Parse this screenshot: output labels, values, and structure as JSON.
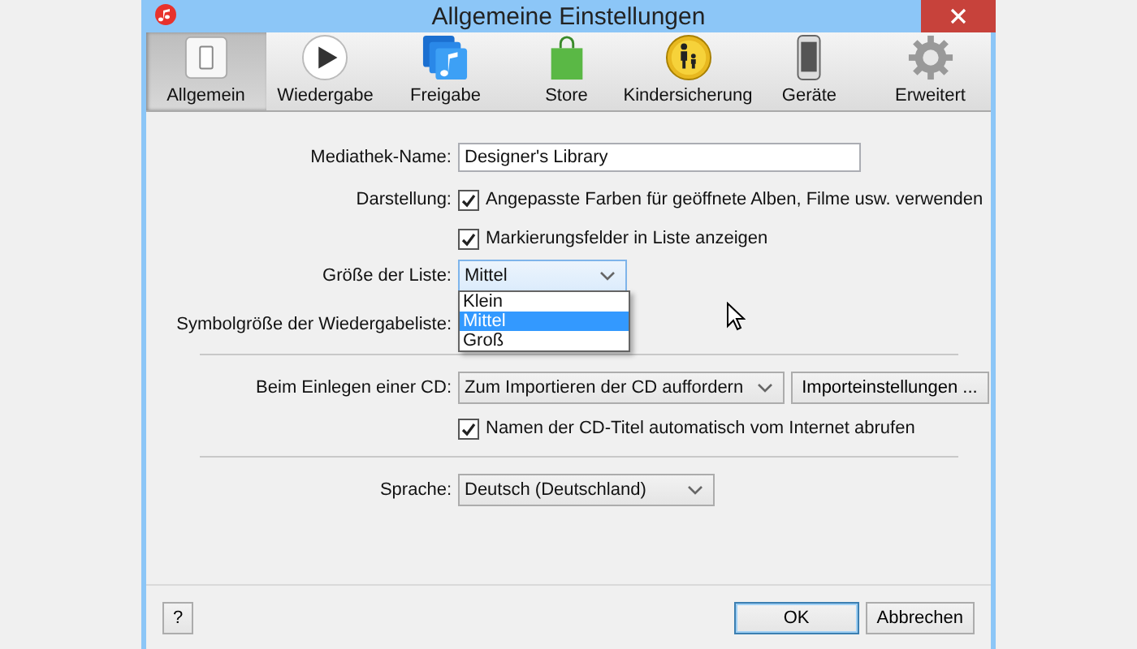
{
  "window": {
    "title": "Allgemeine Einstellungen"
  },
  "tabs": [
    {
      "label": "Allgemein",
      "kind": "switch",
      "selected": true
    },
    {
      "label": "Wiedergabe",
      "kind": "play",
      "selected": false
    },
    {
      "label": "Freigabe",
      "kind": "share",
      "selected": false
    },
    {
      "label": "Store",
      "kind": "bag",
      "selected": false
    },
    {
      "label": "Kindersicherung",
      "kind": "parental",
      "selected": false
    },
    {
      "label": "Geräte",
      "kind": "phone",
      "selected": false
    },
    {
      "label": "Erweitert",
      "kind": "gear",
      "selected": false
    }
  ],
  "form": [
    {
      "kind": "text",
      "label": "Mediathek-Name:",
      "value": "Designer's Library"
    },
    {
      "kind": "checkbox",
      "label": "Darstellung:",
      "text": "Angepasste Farben für geöffnete Alben, Filme usw. verwenden",
      "checked": true
    },
    {
      "kind": "checkbox",
      "text": "Markierungsfelder in Liste anzeigen",
      "checked": true
    },
    {
      "kind": "select",
      "label": "Größe der Liste:",
      "value": "Mittel",
      "open": true,
      "options": [
        {
          "label": "Klein",
          "selected": false
        },
        {
          "label": "Mittel",
          "selected": true
        },
        {
          "label": "Groß",
          "selected": false
        }
      ]
    },
    {
      "kind": "label",
      "label": "Symbolgröße der Wiedergabeliste:"
    },
    {
      "kind": "separator"
    },
    {
      "kind": "select",
      "label": "Beim Einlegen einer CD:",
      "value": "Zum Importieren der CD auffordern",
      "open": false,
      "button": "Importeinstellungen ..."
    },
    {
      "kind": "checkbox",
      "text": "Namen der CD-Titel automatisch vom Internet abrufen",
      "checked": true
    },
    {
      "kind": "separator"
    },
    {
      "kind": "select",
      "label": "Sprache:",
      "value": "Deutsch (Deutschland)",
      "open": false
    }
  ],
  "footer": {
    "help": "?",
    "buttons": [
      {
        "label": "OK",
        "default": true
      },
      {
        "label": "Abbrechen",
        "default": false
      }
    ]
  }
}
